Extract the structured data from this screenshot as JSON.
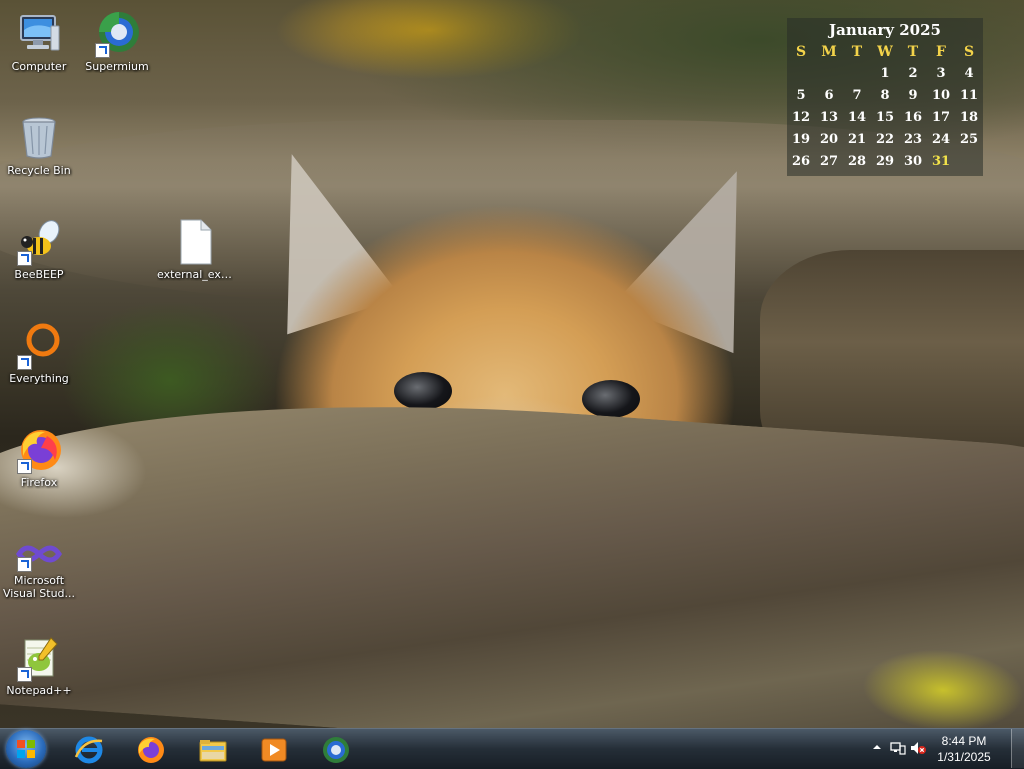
{
  "desktop": {
    "icons": [
      {
        "label": "Computer"
      },
      {
        "label": "Supermium"
      },
      {
        "label": "Recycle Bin"
      },
      {
        "label": "BeeBEEP"
      },
      {
        "label": "external_ext..."
      },
      {
        "label": "Everything"
      },
      {
        "label": "Firefox"
      },
      {
        "label": "Microsoft Visual Stud..."
      },
      {
        "label": "Notepad++"
      }
    ]
  },
  "calendar": {
    "title": "January 2025",
    "weekdays": [
      "S",
      "M",
      "T",
      "W",
      "T",
      "F",
      "S"
    ],
    "weeks": [
      [
        "",
        "",
        "",
        "1",
        "2",
        "3",
        "4"
      ],
      [
        "5",
        "6",
        "7",
        "8",
        "9",
        "10",
        "11"
      ],
      [
        "12",
        "13",
        "14",
        "15",
        "16",
        "17",
        "18"
      ],
      [
        "19",
        "20",
        "21",
        "22",
        "23",
        "24",
        "25"
      ],
      [
        "26",
        "27",
        "28",
        "29",
        "30",
        "31",
        ""
      ]
    ],
    "today": "31",
    "today_color": "#f3e34a",
    "weekday_color": "#f3d34a"
  },
  "taskbar": {
    "pinned": [
      {
        "icon": "internet-explorer-icon"
      },
      {
        "icon": "firefox-icon"
      },
      {
        "icon": "file-explorer-icon"
      },
      {
        "icon": "media-player-icon"
      },
      {
        "icon": "supermium-icon"
      }
    ],
    "tray": {
      "time": "8:44 PM",
      "date": "1/31/2025"
    }
  }
}
